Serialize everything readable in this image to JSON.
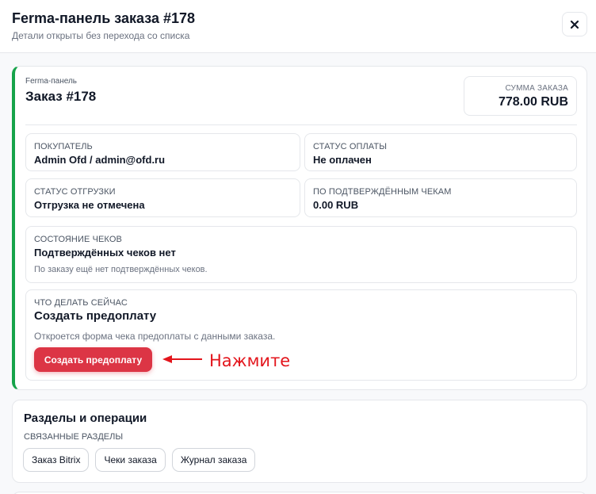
{
  "header": {
    "title": "Ferma-панель заказа #178",
    "subtitle": "Детали открыты без перехода со списка",
    "close_icon": "close-icon"
  },
  "order": {
    "eyebrow": "Ferma-панель",
    "title": "Заказ #178",
    "accent_color": "#16a34a",
    "sum": {
      "label": "СУММА ЗАКАЗА",
      "value": "778.00 RUB"
    },
    "buyer": {
      "label": "ПОКУПАТЕЛЬ",
      "value": "Admin Ofd / admin@ofd.ru"
    },
    "payment_status": {
      "label": "СТАТУС ОПЛАТЫ",
      "value": "Не оплачен"
    },
    "shipment_status": {
      "label": "СТАТУС ОТГРУЗКИ",
      "value": "Отгрузка не отмечена"
    },
    "confirmed_receipts": {
      "label": "ПО ПОДТВЕРЖДЁННЫМ ЧЕКАМ",
      "value": "0.00 RUB"
    },
    "receipts_state": {
      "label": "СОСТОЯНИЕ ЧЕКОВ",
      "value": "Подтверждённых чеков нет",
      "note": "По заказу ещё нет подтверждённых чеков."
    },
    "next_action": {
      "label": "ЧТО ДЕЛАТЬ СЕЙЧАС",
      "title": "Создать предоплату",
      "note": "Откроется форма чека предоплаты с данными заказа.",
      "button_label": "Создать предоплату",
      "button_color": "#dc3545"
    }
  },
  "annotation": {
    "text": "Нажмите",
    "color": "#e3151c",
    "arrow_icon": "arrow-left-icon"
  },
  "sections": {
    "title": "Разделы и операции",
    "label": "СВЯЗАННЫЕ РАЗДЕЛЫ",
    "links": [
      "Заказ Bitrix",
      "Чеки заказа",
      "Журнал заказа"
    ]
  }
}
